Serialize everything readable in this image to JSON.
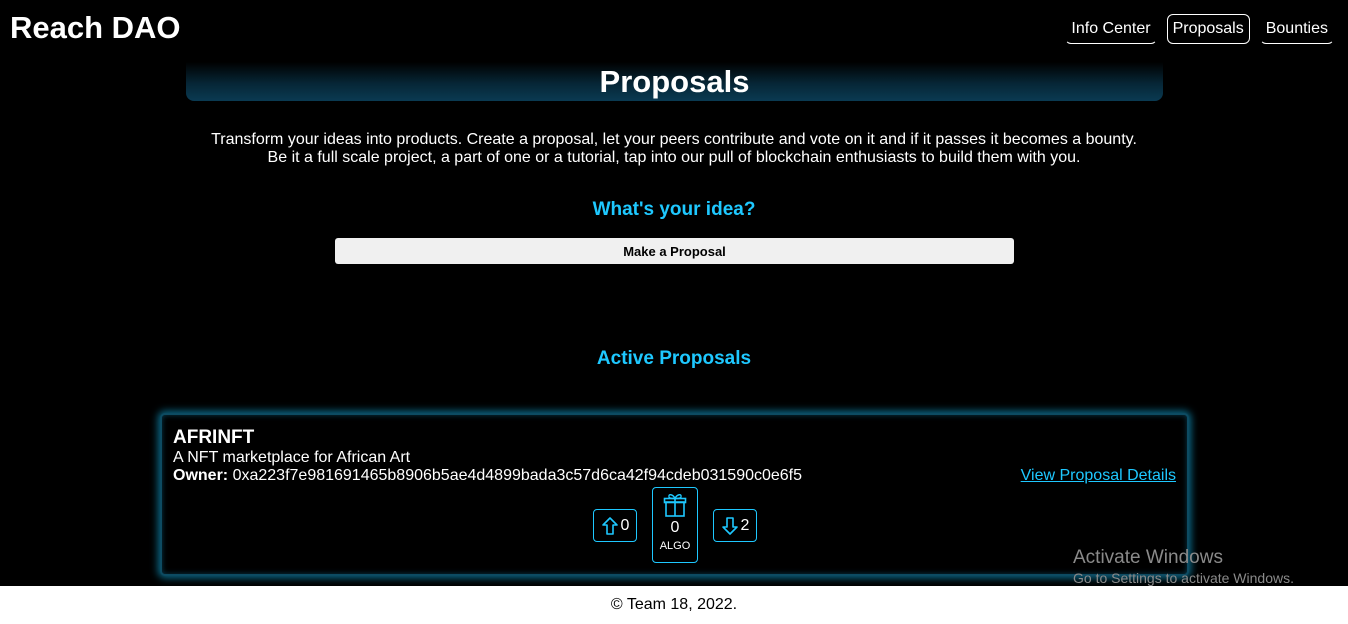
{
  "brand": "Reach DAO",
  "nav": {
    "items": [
      "Info Center",
      "Proposals",
      "Bounties"
    ],
    "active": "Proposals"
  },
  "page": {
    "title": "Proposals",
    "intro_line1": "Transform your ideas into products. Create a proposal, let your peers contribute and vote on it and if it passes it becomes a bounty.",
    "intro_line2": "Be it a full scale project, a part of one or a tutorial, tap into our pull of blockchain enthusiasts to build them with you.",
    "idea_heading": "What's your idea?",
    "make_button": "Make a Proposal",
    "active_heading": "Active Proposals"
  },
  "proposals": [
    {
      "title": "AFRINFT",
      "description": "A NFT marketplace for African Art",
      "owner_label": "Owner:",
      "owner": "0xa223f7e981691465b8906b5ae4d4899bada3c57d6ca42f94cdeb031590c0e6f5",
      "details_link": "View Proposal Details",
      "upvotes": "0",
      "contribution": "0",
      "currency": "ALGO",
      "downvotes": "2",
      "icons": {
        "upvote": "arrow-up-icon",
        "fund": "gift-icon",
        "downvote": "arrow-down-icon"
      }
    }
  ],
  "footer": "© Team 18, 2022.",
  "watermark": {
    "line1": "Activate Windows",
    "line2": "Go to Settings to activate Windows."
  },
  "colors": {
    "accent": "#1ec8ff",
    "background": "#000000",
    "footer_bg": "#ffffff"
  }
}
